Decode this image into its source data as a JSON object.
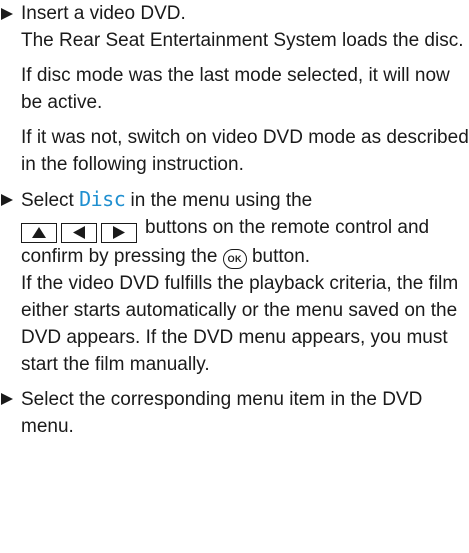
{
  "steps": [
    {
      "action": "Insert a video DVD.",
      "results": [
        "The Rear Seat Entertainment System loads the disc.",
        "If disc mode was the last mode selected, it will now be active.",
        "If it was not, switch on video DVD mode as described in the following instruction."
      ]
    },
    {
      "action_before": "Select",
      "keyword": "Disc",
      "action_middle": "in the menu using the",
      "action_after": "buttons on the remote control and confirm by pressing the",
      "ok_label": "OK",
      "action_end": "button.",
      "result": "If the video DVD fulfills the playback criteria, the film either starts automatically or the menu saved on the DVD appears. If the DVD menu appears, you must start the film manually."
    },
    {
      "action": "Select the corresponding menu item in the DVD menu."
    }
  ],
  "icons": {
    "bullet": "triangle-right-icon",
    "keys": [
      "up-arrow-key-icon",
      "left-arrow-key-icon",
      "right-arrow-key-icon"
    ]
  },
  "colors": {
    "text": "#1a1a1a",
    "keyword": "#1f8fd0"
  }
}
